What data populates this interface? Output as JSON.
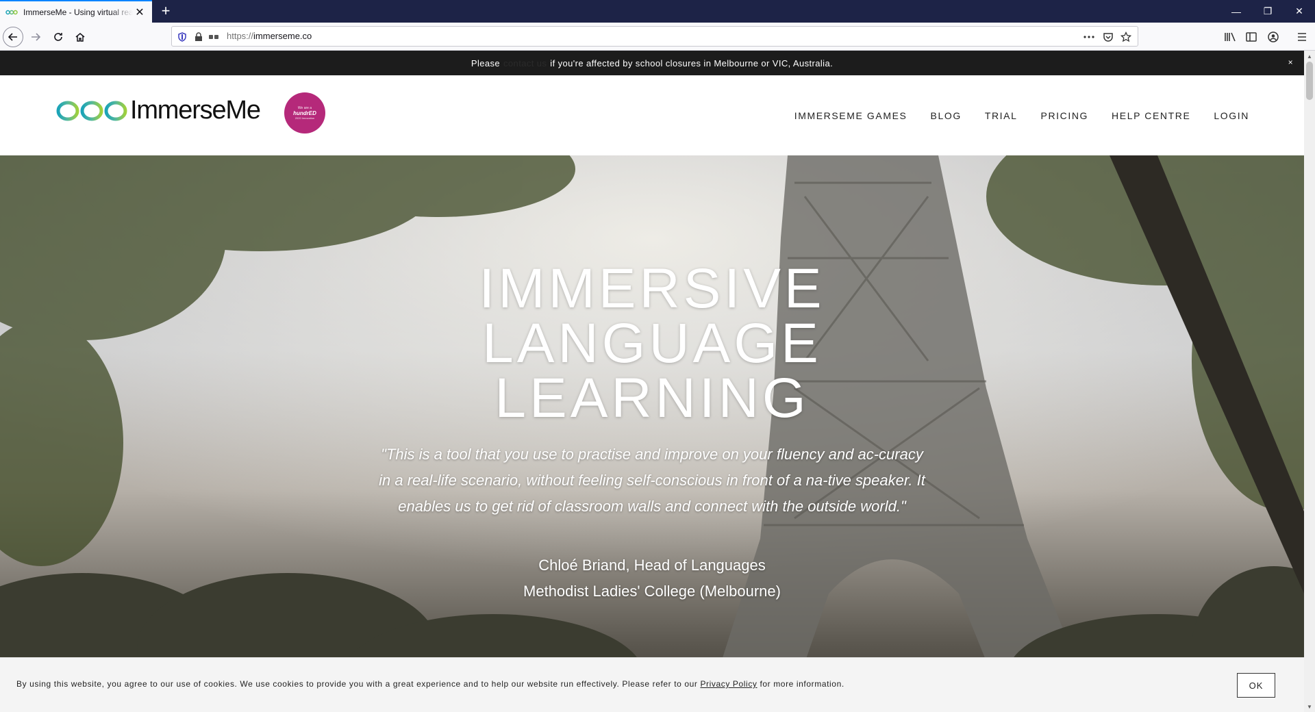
{
  "browser": {
    "tab_title": "ImmerseMe - Using virtual reality for language learning",
    "new_tab_label": "+",
    "url_scheme": "https://",
    "url_host": "immerseme.co",
    "window_controls": {
      "minimize": "—",
      "restore": "❐",
      "close": "✕"
    },
    "icons": [
      "back-icon",
      "forward-icon",
      "reload-icon",
      "home-icon",
      "shield-icon",
      "lock-icon",
      "permissions-icon",
      "page-actions-icon",
      "pocket-icon",
      "bookmark-star-icon",
      "library-icon",
      "sidebar-icon",
      "account-icon",
      "menu-icon"
    ]
  },
  "notice": {
    "prefix": "Please",
    "link": "contact us",
    "suffix": "if you're affected by school closures in Melbourne or VIC, Australia.",
    "close": "×"
  },
  "header": {
    "logo_text": "ImmerseMe",
    "badge": {
      "line1": "We are a",
      "brand": "hundrED",
      "line3": "2020 Innovation"
    },
    "nav": [
      "IMMERSEME GAMES",
      "BLOG",
      "TRIAL",
      "PRICING",
      "HELP CENTRE",
      "LOGIN"
    ]
  },
  "hero": {
    "title_lines": [
      "IMMERSIVE",
      "LANGUAGE",
      "LEARNING"
    ],
    "quote": "\"This is a tool that you use to practise and improve on your fluency and ac-curacy in a real-life scenario, without feeling self-conscious in front of a na-tive speaker. It enables us to get rid of classroom walls and connect with the outside world.\"",
    "attribution_name": "Chloé Briand, Head of Languages",
    "attribution_org": "Methodist Ladies' College (Melbourne)"
  },
  "cookie": {
    "text_before": "By using this website, you agree to our use of cookies. We use cookies to provide you with a great experience and to help our website run effectively. Please refer to our",
    "link": "Privacy Policy",
    "text_after": "for more information.",
    "ok_label": "OK"
  },
  "colors": {
    "titlebar": "#1d2347",
    "accent_blue": "#0a84ff",
    "badge": "#b5297a",
    "logo_teal": "#1aa3b8",
    "logo_green": "#8cc63f"
  }
}
